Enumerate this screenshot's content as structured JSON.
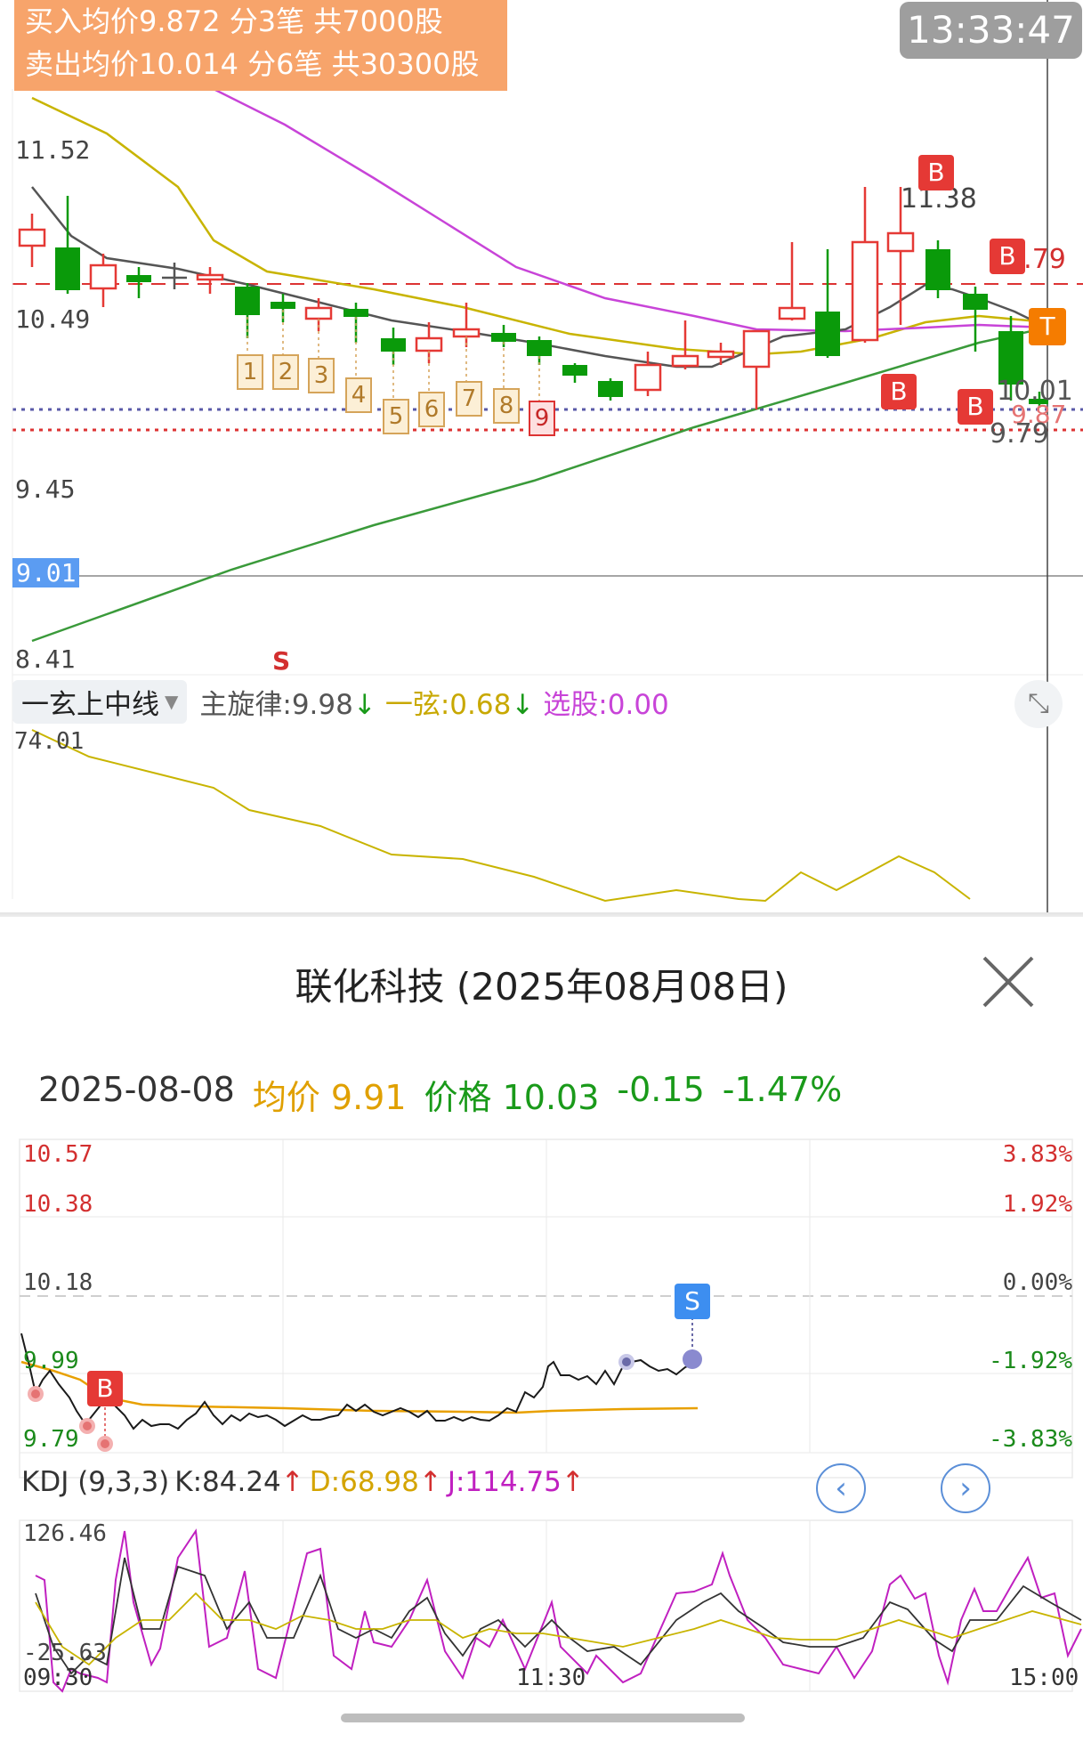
{
  "banner": {
    "buy_line": "买入均价9.872 分3笔 共7000股",
    "sell_line": "卖出均价10.014 分6笔 共30300股"
  },
  "clock": "13:33:47",
  "kline": {
    "price_labels": [
      "11.52",
      "10.49",
      "9.45",
      "9.01",
      "8.41"
    ],
    "highlight_price": "9.01",
    "annotations": {
      "high": "11.38",
      "right_top": "10.79",
      "right_mid": "10.01",
      "right_red": "9.87",
      "right_low": "9.79"
    },
    "td_counts": [
      "1",
      "2",
      "3",
      "4",
      "5",
      "6",
      "7",
      "8",
      "9"
    ],
    "markers": {
      "buy": "B",
      "sell": "S",
      "t": "T"
    }
  },
  "indicator": {
    "select_label": "一玄上中线",
    "line1_label": "主旋律:9.98",
    "line2_label": "一弦:0.68",
    "line3_label": "选股:0.00",
    "arrow_down": "↓",
    "sub_top": "74.01"
  },
  "sheet": {
    "title": "联化科技 (2025年08月08日)",
    "date": "2025-08-08",
    "avg": "均价 9.91",
    "price": "价格 10.03",
    "change": "-0.15",
    "change_pct": "-1.47%",
    "left_axis": [
      "10.57",
      "10.38",
      "10.18",
      "9.99",
      "9.79"
    ],
    "right_axis": [
      "3.83%",
      "1.92%",
      "0.00%",
      "-1.92%",
      "-3.83%"
    ],
    "marker_buy": "B",
    "marker_sell": "S",
    "kdj": {
      "name": "KDJ (9,3,3)",
      "k": "K:84.24",
      "d": "D:68.98",
      "j": "J:114.75",
      "up": "↑",
      "top": "126.46",
      "bottom": "-25.63"
    },
    "times": [
      "09:30",
      "11:30",
      "15:00"
    ],
    "nav_prev": "‹",
    "nav_next": "›"
  },
  "colors": {
    "up_red": "#e53935",
    "down_green": "#0a9a0a",
    "ma_gray": "#555555",
    "ma_yellow": "#c8b400",
    "ma_purple": "#c844d8",
    "ma_green": "#3a9a3a",
    "avg_orange": "#e8a000"
  }
}
